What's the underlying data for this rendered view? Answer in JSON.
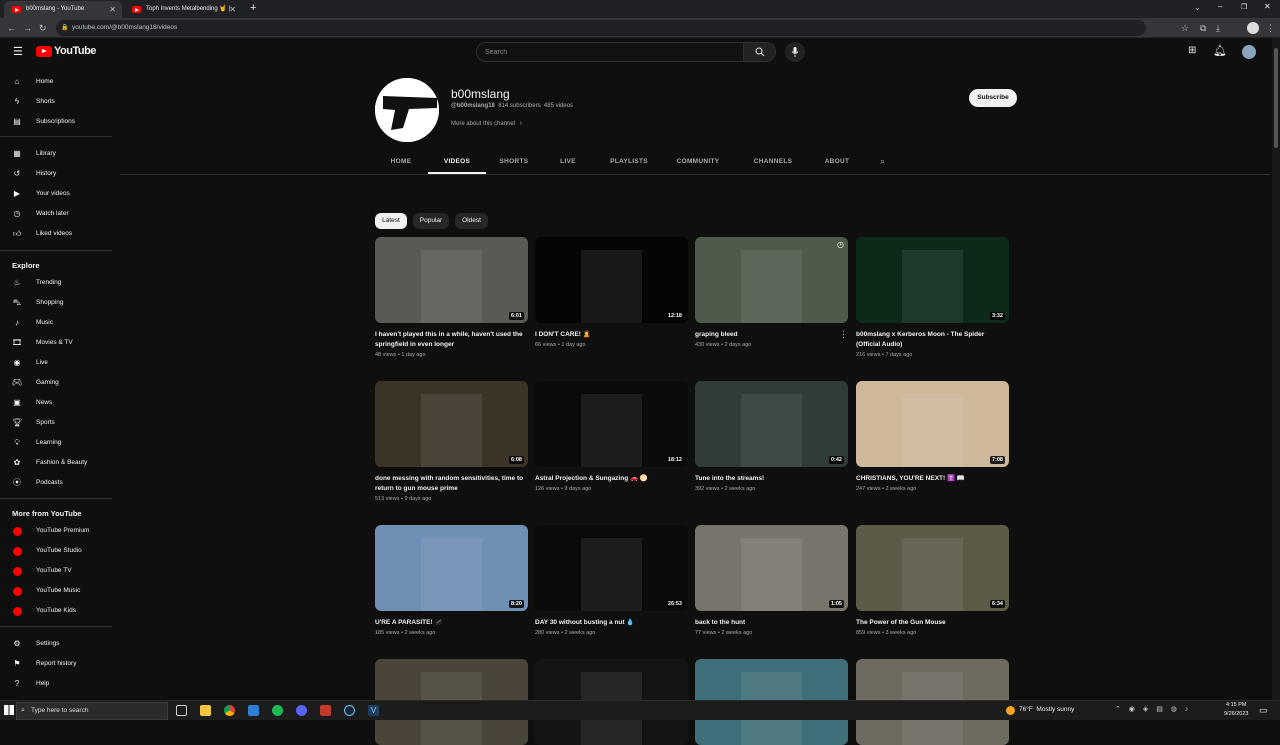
{
  "browser": {
    "tabs": [
      {
        "title": "b00mslang - YouTube",
        "active": true
      },
      {
        "title": "Toph Invents Metalbending 🤘 | ",
        "active": false
      }
    ],
    "url": "youtube.com/@b00mslang18/videos"
  },
  "yt": {
    "logo": "YouTube",
    "search_placeholder": "Search"
  },
  "sidebar": {
    "main": [
      {
        "label": "Home",
        "icon": "home-icon"
      },
      {
        "label": "Shorts",
        "icon": "shorts-icon"
      },
      {
        "label": "Subscriptions",
        "icon": "subscriptions-icon"
      }
    ],
    "library": [
      {
        "label": "Library",
        "icon": "library-icon"
      },
      {
        "label": "History",
        "icon": "history-icon"
      },
      {
        "label": "Your videos",
        "icon": "your-videos-icon"
      },
      {
        "label": "Watch later",
        "icon": "watch-later-icon"
      },
      {
        "label": "Liked videos",
        "icon": "liked-icon"
      }
    ],
    "explore_heading": "Explore",
    "explore": [
      {
        "label": "Trending",
        "icon": "trending-icon"
      },
      {
        "label": "Shopping",
        "icon": "shopping-icon"
      },
      {
        "label": "Music",
        "icon": "music-icon"
      },
      {
        "label": "Movies & TV",
        "icon": "movies-icon"
      },
      {
        "label": "Live",
        "icon": "live-icon"
      },
      {
        "label": "Gaming",
        "icon": "gaming-icon"
      },
      {
        "label": "News",
        "icon": "news-icon"
      },
      {
        "label": "Sports",
        "icon": "sports-icon"
      },
      {
        "label": "Learning",
        "icon": "learning-icon"
      },
      {
        "label": "Fashion & Beauty",
        "icon": "fashion-icon"
      },
      {
        "label": "Podcasts",
        "icon": "podcasts-icon"
      }
    ],
    "more_heading": "More from YouTube",
    "more": [
      {
        "label": "YouTube Premium"
      },
      {
        "label": "YouTube Studio"
      },
      {
        "label": "YouTube TV"
      },
      {
        "label": "YouTube Music"
      },
      {
        "label": "YouTube Kids"
      }
    ],
    "bottom": [
      {
        "label": "Settings",
        "icon": "settings-icon"
      },
      {
        "label": "Report history",
        "icon": "flag-icon"
      },
      {
        "label": "Help",
        "icon": "help-icon"
      }
    ]
  },
  "channel": {
    "name": "b00mslang",
    "handle": "@b00mslang18",
    "subscribers": "814 subscribers",
    "videos_count": "485 videos",
    "more_about": "More about this channel",
    "subscribe_label": "Subscribe",
    "tabs": [
      "HOME",
      "VIDEOS",
      "SHORTS",
      "LIVE",
      "PLAYLISTS",
      "COMMUNITY",
      "CHANNELS",
      "ABOUT"
    ],
    "active_tab": "VIDEOS"
  },
  "chips": [
    "Latest",
    "Popular",
    "Oldest"
  ],
  "videos": [
    {
      "title": "I haven't played this in a while, haven't used the springfield in even longer",
      "meta": "48 views • 1 day ago",
      "duration": "6:01",
      "thumb_color": "#5a5a55"
    },
    {
      "title": "I DON'T CARE! 🙎",
      "meta": "66 views • 1 day ago",
      "duration": "12:18",
      "thumb_color": "#050505"
    },
    {
      "title": "graping bleed",
      "meta": "430 views • 2 days ago",
      "duration": "",
      "thumb_color": "#4e5b4b"
    },
    {
      "title": "b00mslang x Kerberos Moon - The Spider (Official Audio)",
      "meta": "216 views • 7 days ago",
      "duration": "3:32",
      "thumb_color": "#0b2a18"
    },
    {
      "title": "done messing with random sensitivities, time to return to gun mouse prime",
      "meta": "513 views • 9 days ago",
      "duration": "6:08",
      "thumb_color": "#3b3326"
    },
    {
      "title": "Astral Projection & Sungazing 🚗 🌕",
      "meta": "126 views • 9 days ago",
      "duration": "18:12",
      "thumb_color": "#0a0a0a"
    },
    {
      "title": "Tune into the streams!",
      "meta": "392 views • 2 weeks ago",
      "duration": "0:42",
      "thumb_color": "#2f3c3a"
    },
    {
      "title": "CHRISTIANS, YOU'RE NEXT! ✝️ 📖",
      "meta": "247 views • 2 weeks ago",
      "duration": "7:08",
      "thumb_color": "#cdb89a"
    },
    {
      "title": "U'RE A PARASITE! 🦟",
      "meta": "185 views • 2 weeks ago",
      "duration": "8:20",
      "thumb_color": "#6f8fb5"
    },
    {
      "title": "DAY 30 without busting a nut 💧",
      "meta": "280 views • 2 weeks ago",
      "duration": "26:53",
      "thumb_color": "#0a0a0a"
    },
    {
      "title": "back to the hunt",
      "meta": "77 views • 2 weeks ago",
      "duration": "1:05",
      "thumb_color": "#7a756c"
    },
    {
      "title": "The Power of the Gun Mouse",
      "meta": "859 views • 3 weeks ago",
      "duration": "6:34",
      "thumb_color": "#5e5a48"
    },
    {
      "title": "",
      "meta": "",
      "duration": "",
      "thumb_color": "#4a4538"
    },
    {
      "title": "",
      "meta": "",
      "duration": "",
      "thumb_color": "#141414"
    },
    {
      "title": "",
      "meta": "",
      "duration": "",
      "thumb_color": "#3f6f78"
    },
    {
      "title": "",
      "meta": "",
      "duration": "",
      "thumb_color": "#6e6a60"
    }
  ],
  "taskbar": {
    "search_placeholder": "Type here to search",
    "weather": "76°F  Mostly sunny",
    "time": "4:15 PM",
    "date": "9/26/2023"
  }
}
